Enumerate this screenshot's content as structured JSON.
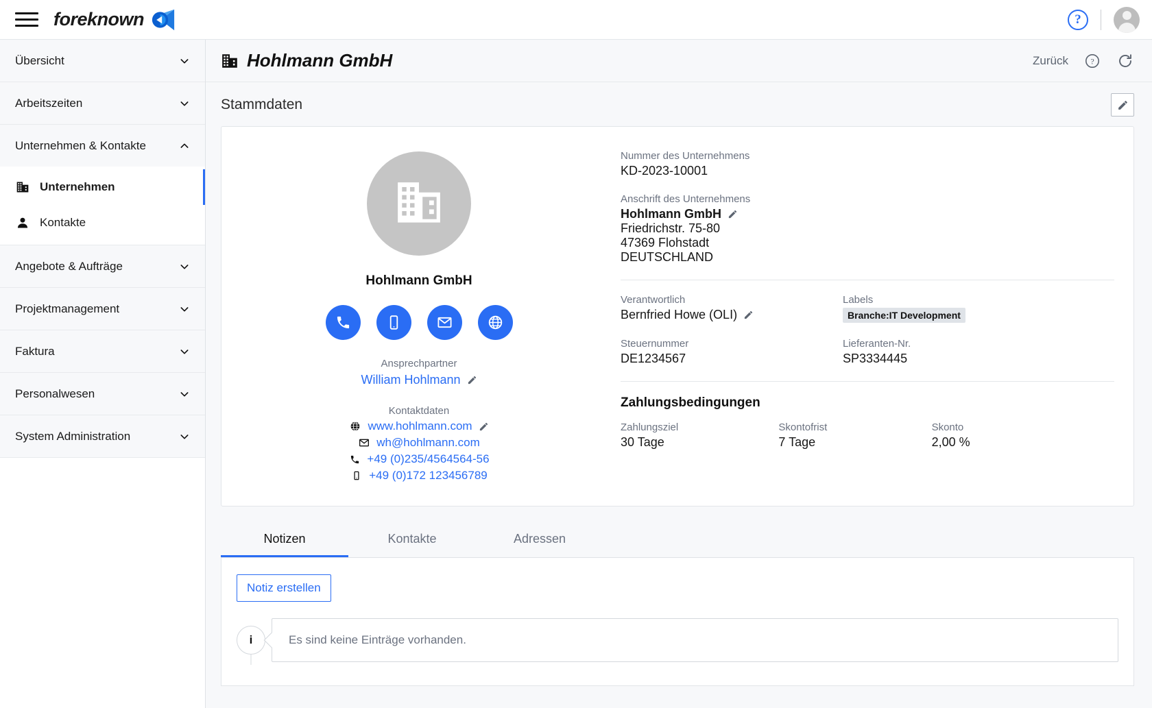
{
  "topbar": {
    "menu_icon": "hamburger-icon",
    "brand": "foreknown",
    "help_icon": "help-circle-icon",
    "help_glyph": "?",
    "avatar_icon": "user-avatar-icon"
  },
  "sidebar": {
    "groups": [
      {
        "label": "Übersicht",
        "expanded": false,
        "icon": "chevron-down-icon"
      },
      {
        "label": "Arbeitszeiten",
        "expanded": false,
        "icon": "chevron-down-icon"
      },
      {
        "label": "Unternehmen & Kontakte",
        "expanded": true,
        "icon": "chevron-up-icon",
        "items": [
          {
            "label": "Unternehmen",
            "icon": "building-icon",
            "active": true
          },
          {
            "label": "Kontakte",
            "icon": "person-icon",
            "active": false
          }
        ]
      },
      {
        "label": "Angebote & Aufträge",
        "expanded": false,
        "icon": "chevron-down-icon"
      },
      {
        "label": "Projektmanagement",
        "expanded": false,
        "icon": "chevron-down-icon"
      },
      {
        "label": "Faktura",
        "expanded": false,
        "icon": "chevron-down-icon"
      },
      {
        "label": "Personalwesen",
        "expanded": false,
        "icon": "chevron-down-icon"
      },
      {
        "label": "System Administration",
        "expanded": false,
        "icon": "chevron-down-icon"
      }
    ]
  },
  "page": {
    "title": "Hohlmann GmbH",
    "title_icon": "building-icon",
    "back_label": "Zurück",
    "help_icon": "help-circle-icon",
    "refresh_icon": "refresh-icon",
    "section_title": "Stammdaten",
    "edit_icon": "pencil-icon"
  },
  "profile": {
    "avatar_icon": "building-icon",
    "company_name": "Hohlmann GmbH",
    "actions": [
      {
        "icon": "phone-icon",
        "name": "call-button"
      },
      {
        "icon": "mobile-icon",
        "name": "mobile-button"
      },
      {
        "icon": "mail-icon",
        "name": "email-button"
      },
      {
        "icon": "globe-icon",
        "name": "website-button"
      }
    ],
    "contact_person_label": "Ansprechpartner",
    "contact_person": "William Hohlmann",
    "contact_data_label": "Kontaktdaten",
    "contact_lines": [
      {
        "icon": "globe-icon",
        "value": "www.hohlmann.com",
        "editable": true
      },
      {
        "icon": "mail-icon",
        "value": "wh@hohlmann.com",
        "editable": false
      },
      {
        "icon": "phone-icon",
        "value": "+49 (0)235/4564564-56",
        "editable": false
      },
      {
        "icon": "mobile-icon",
        "value": "+49 (0)172 123456789",
        "editable": false
      }
    ]
  },
  "details": {
    "number_label": "Nummer des Unternehmens",
    "number_value": "KD-2023-10001",
    "address_label": "Anschrift des Unternehmens",
    "address_company": "Hohlmann GmbH",
    "address_street": "Friedrichstr. 75-80",
    "address_city": "47369 Flohstadt",
    "address_country": "DEUTSCHLAND",
    "responsible_label": "Verantwortlich",
    "responsible_value": "Bernfried Howe (OLI)",
    "labels_label": "Labels",
    "labels_badge": "Branche:IT Development",
    "tax_label": "Steuernummer",
    "tax_value": "DE1234567",
    "supplier_label": "Lieferanten-Nr.",
    "supplier_value": "SP3334445",
    "payment_title": "Zahlungsbedingungen",
    "payment_target_label": "Zahlungsziel",
    "payment_target_value": "30 Tage",
    "discount_period_label": "Skontofrist",
    "discount_period_value": "7 Tage",
    "discount_label": "Skonto",
    "discount_value": "2,00 %"
  },
  "tabs": [
    {
      "label": "Notizen",
      "active": true
    },
    {
      "label": "Kontakte",
      "active": false
    },
    {
      "label": "Adressen",
      "active": false
    }
  ],
  "notes": {
    "create_button": "Notiz erstellen",
    "info_glyph": "i",
    "empty_message": "Es sind keine Einträge vorhanden."
  },
  "colors": {
    "accent": "#2a6df4",
    "sidebar_group_bg": "#f7f8fa",
    "page_bg": "#f7f8fa",
    "muted_text": "#6b7280",
    "badge_bg": "#dfe3e8"
  }
}
